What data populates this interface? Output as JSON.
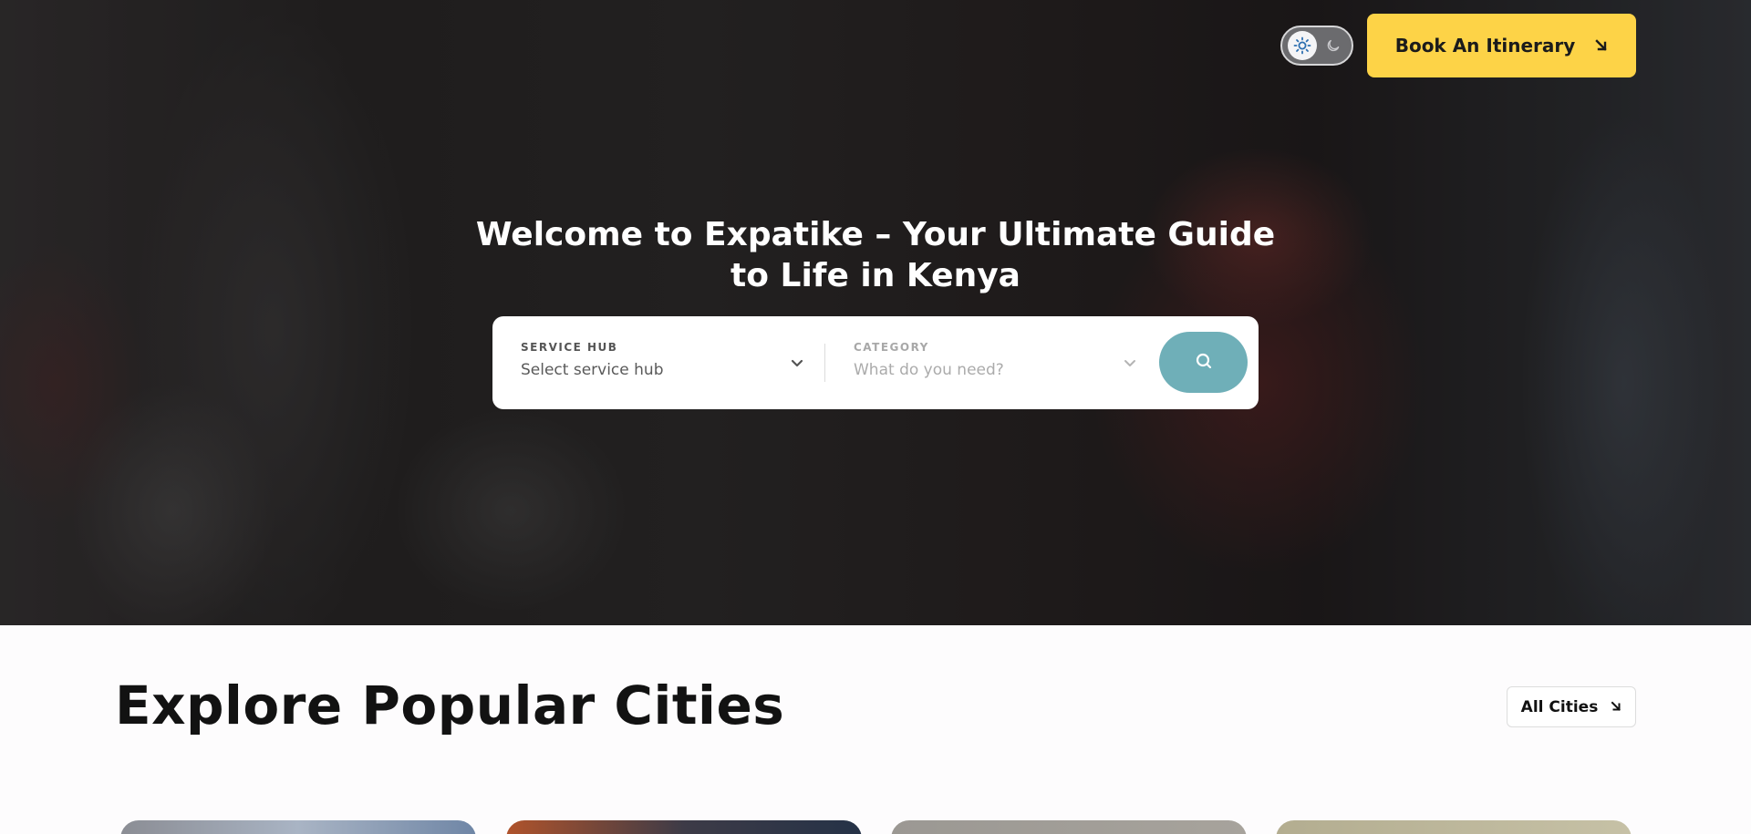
{
  "header": {
    "theme_toggle": {
      "light_icon": "sun-icon",
      "dark_icon": "moon-icon",
      "mode": "light"
    },
    "book_button": {
      "label": "Book An Itinerary",
      "icon": "arrow-down-right-icon",
      "color": "#fdd347"
    }
  },
  "hero": {
    "title": "Welcome to Expatike – Your Ultimate Guide to Life in Kenya",
    "search": {
      "service_hub": {
        "label": "SERVICE HUB",
        "value": "Select service hub"
      },
      "category": {
        "label": "CATEGORY",
        "placeholder": "What do you need?"
      },
      "search_button_icon": "search-icon",
      "search_button_color": "#6fafb8"
    }
  },
  "cities": {
    "title": "Explore Popular Cities",
    "all_button": {
      "label": "All Cities",
      "icon": "arrow-down-right-icon"
    }
  }
}
